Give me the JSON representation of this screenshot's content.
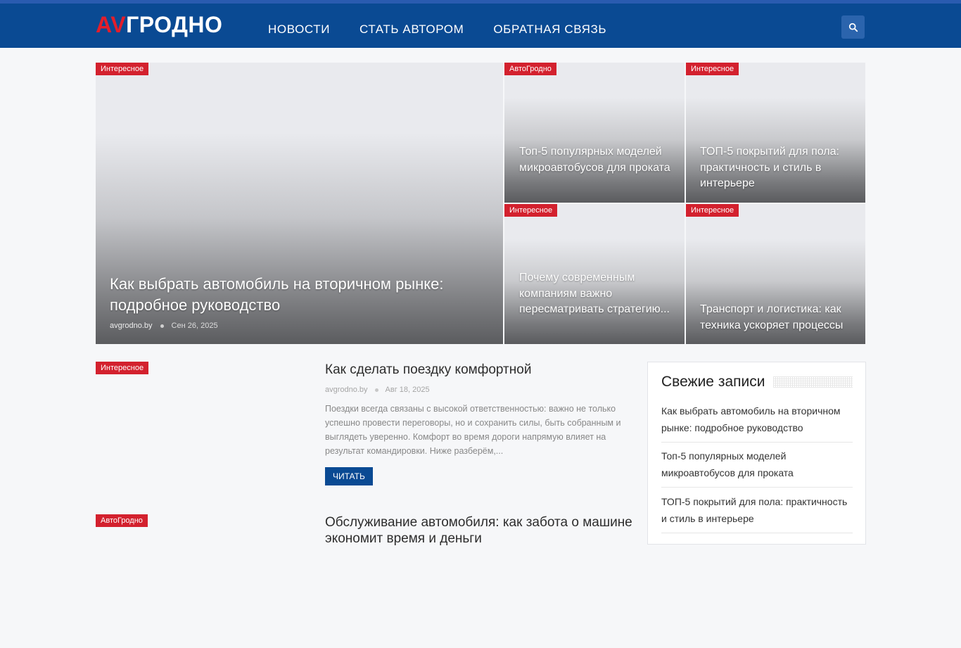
{
  "header": {
    "logo_av": "AV",
    "logo_city": "ГРОДНО",
    "nav": [
      "НОВОСТИ",
      "СТАТЬ АВТОРОМ",
      "ОБРАТНАЯ СВЯЗЬ"
    ],
    "search_icon": "search-icon"
  },
  "featured": {
    "main": {
      "category": "Интересное",
      "title": "Как выбрать автомобиль на вторичном рынке: подробное руководство",
      "author": "avgrodno.by",
      "date": "Сен 26, 2025"
    },
    "tiles": [
      {
        "category": "АвтоГродно",
        "title": "Топ-5 популярных моделей микроавтобусов для проката"
      },
      {
        "category": "Интересное",
        "title": "ТОП-5 покрытий для пола: практичность и стиль в интерьере"
      },
      {
        "category": "Интересное",
        "title": "Почему современным компаниям важно пересматривать стратегию..."
      },
      {
        "category": "Интересное",
        "title": "Транспорт и логистика: как техника ускоряет процессы"
      }
    ]
  },
  "posts": [
    {
      "category": "Интересное",
      "title": "Как сделать поездку комфортной",
      "author": "avgrodno.by",
      "date": "Авг 18, 2025",
      "excerpt": "Поездки всегда связаны с высокой ответственностью: важно не только успешно провести переговоры, но и сохранить силы, быть собранным и выглядеть уверенно. Комфорт во время дороги напрямую влияет на результат командировки. Ниже разберём,...",
      "read_label": "ЧИТАТЬ"
    },
    {
      "category": "АвтоГродно",
      "title": "Обслуживание автомобиля: как забота о машине экономит время и деньги"
    }
  ],
  "sidebar": {
    "title": "Свежие записи",
    "items": [
      "Как выбрать автомобиль на вторичном рынке: подробное руководство",
      "Топ-5 популярных моделей микроавтобусов для проката",
      "ТОП-5 покрытий для пола: практичность и стиль в интерьере"
    ]
  },
  "colors": {
    "header_bg": "#0a4a93",
    "accent_red": "#d3212e",
    "read_button": "#0a4a93"
  }
}
